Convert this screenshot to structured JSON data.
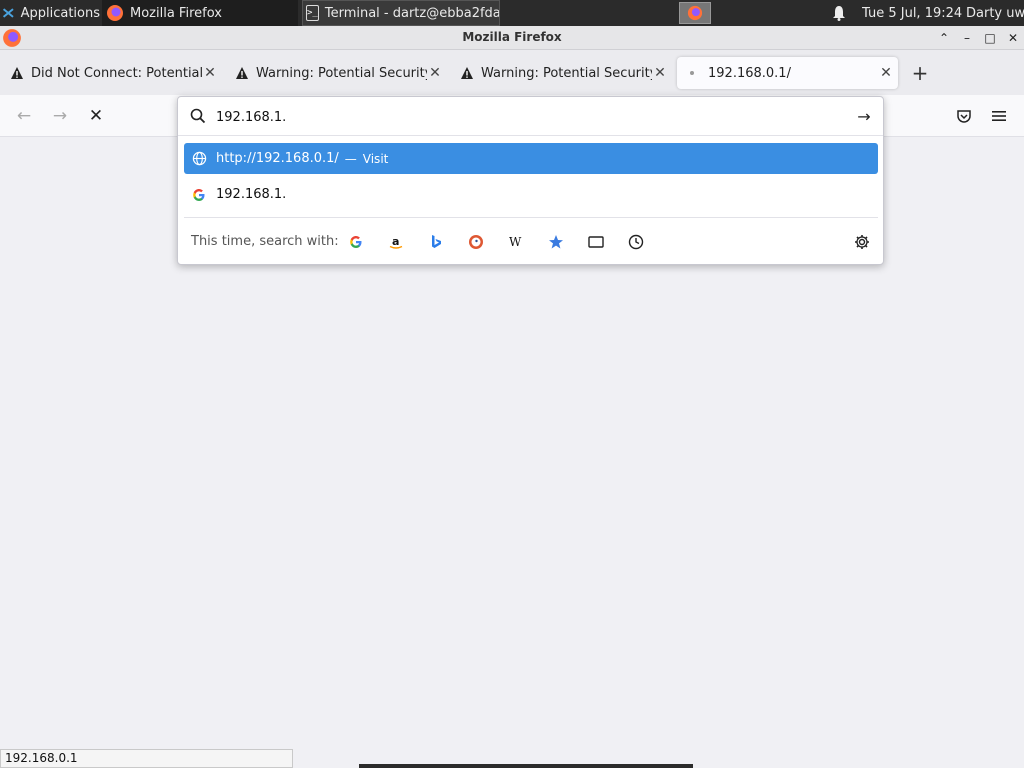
{
  "taskbar": {
    "applications_label": "Applications",
    "firefox_task": "Mozilla Firefox",
    "terminal_task": "Terminal - dartz@ebba2fda...",
    "clock": "Tue  5 Jul, 19:24",
    "user": "Darty uwu"
  },
  "window": {
    "title": "Mozilla Firefox",
    "minimize_glyph": "–",
    "maximize_glyph": "□",
    "close_glyph": "✕",
    "collapse_glyph": "⌃"
  },
  "tabs": [
    {
      "title": "Did Not Connect: Potential Security Issue",
      "icon": "warning-icon",
      "active": false
    },
    {
      "title": "Warning: Potential Security Risk Ahead",
      "icon": "warning-icon",
      "active": false
    },
    {
      "title": "Warning: Potential Security Risk Ahead",
      "icon": "warning-icon",
      "active": false
    },
    {
      "title": "192.168.0.1/",
      "icon": "loading-dot-icon",
      "active": true
    }
  ],
  "tab_close_glyph": "✕",
  "new_tab_glyph": "+",
  "nav": {
    "back_glyph": "←",
    "forward_glyph": "→",
    "stop_glyph": "✕"
  },
  "urlbar": {
    "value": "192.168.1.",
    "go_glyph": "→",
    "results": [
      {
        "text": "http://192.168.0.1/",
        "separator": "—",
        "action": "Visit",
        "icon": "globe-icon",
        "selected": true
      },
      {
        "text": "192.168.1.",
        "icon": "google-icon",
        "selected": false
      }
    ],
    "search_with_label": "This time, search with:",
    "engines": [
      {
        "name": "google-engine-icon",
        "glyph": "G",
        "color": "#4285f4"
      },
      {
        "name": "amazon-engine-icon",
        "glyph": "a",
        "color": "#111111"
      },
      {
        "name": "bing-engine-icon",
        "glyph": "b",
        "color": "#2b7de9"
      },
      {
        "name": "duckduckgo-engine-icon",
        "glyph": "D",
        "color": "#de5833"
      },
      {
        "name": "wikipedia-engine-icon",
        "glyph": "W",
        "color": "#111111"
      },
      {
        "name": "bookmarks-engine-icon",
        "glyph": "★",
        "color": "#3a7be0"
      },
      {
        "name": "tabs-engine-icon",
        "glyph": "▭",
        "color": "#222222"
      },
      {
        "name": "history-engine-icon",
        "glyph": "◷",
        "color": "#222222"
      }
    ]
  },
  "status": {
    "link_url": "192.168.0.1"
  },
  "colors": {
    "accent": "#3a8ee2",
    "taskbar": "#2b2b2b"
  }
}
